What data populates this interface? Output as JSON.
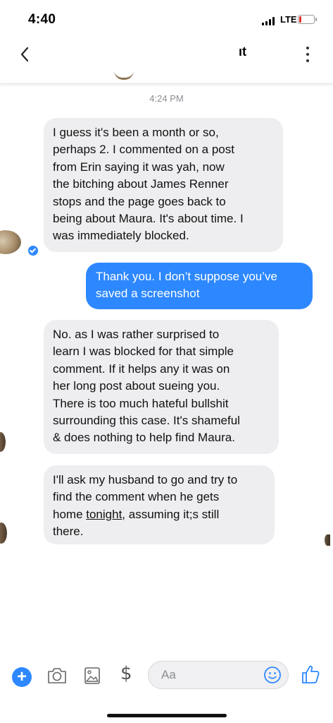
{
  "status_bar": {
    "time": "4:40",
    "network": "LTE",
    "battery_level": 0.1
  },
  "header": {
    "title_fragment": "ıt",
    "back_icon": "chevron-left-icon",
    "menu_icon": "vertical-dots-icon"
  },
  "conversation": {
    "timestamp": "4:24 PM",
    "messages": [
      {
        "from": "them",
        "text": "I guess it's been a month or so,\nperhaps 2. I commented on a post\nfrom Erin saying it was  yah, now\nthe bitching about James Renner\nstops and the page goes back to\nbeing about Maura. It's about time. I\nwas immediately blocked."
      },
      {
        "from": "me",
        "text": "Thank you. I don’t suppose you’ve\nsaved a screenshot"
      },
      {
        "from": "them",
        "text": "No. as I was rather surprised to\nlearn I was blocked for that simple\ncomment. If it helps any it was on\nher long post about sueing you.\nThere is too much hateful bullshit\nsurrounding this case. It's shameful\n& does nothing to help find Maura."
      },
      {
        "from": "them",
        "text_before": "I'll ask my husband to go and try to\nfind the comment when he gets\nhome ",
        "text_link": "tonight",
        "text_after": ", assuming it;s still\nthere."
      }
    ]
  },
  "composer": {
    "placeholder": "Aa",
    "dollar_label": "$",
    "plus_label": "+",
    "icons": [
      "plus-icon",
      "camera-icon",
      "gallery-icon",
      "dollar-icon",
      "emoji-icon",
      "thumbs-up-icon"
    ]
  },
  "colors": {
    "accent": "#2d88ff",
    "incoming_bubble": "#eeeef0",
    "muted_text": "#8a8d91"
  }
}
